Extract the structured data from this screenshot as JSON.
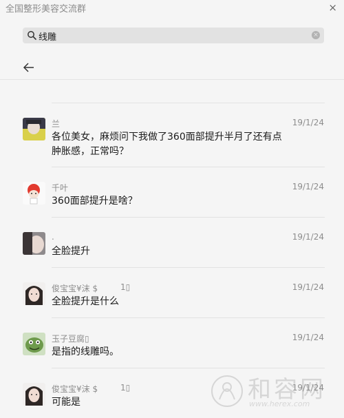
{
  "window": {
    "title": "全国整形美容交流群",
    "close_glyph": "×"
  },
  "search": {
    "value": "线雕",
    "clear_glyph": "×"
  },
  "results": [
    {
      "nickname": "兰",
      "extra": "",
      "date": "19/1/24",
      "message": "各位美女，麻烦问下我做了360面部提升半月了还有点肿胀感，正常吗？"
    },
    {
      "nickname": "千叶",
      "extra": "",
      "date": "19/1/24",
      "message": "360面部提升是啥？"
    },
    {
      "nickname": ".",
      "extra": "",
      "date": "19/1/24",
      "message": "全脸提升"
    },
    {
      "nickname": "俊宝宝¥沫 $",
      "extra": "1▯",
      "date": "19/1/24",
      "message": "全脸提升是什么"
    },
    {
      "nickname": "玉子豆腐▯",
      "extra": "",
      "date": "19/1/24",
      "message": "是指的线雕吗。"
    },
    {
      "nickname": "俊宝宝¥沫 $",
      "extra": "1▯",
      "date": "19/1/24",
      "message": "可能是"
    }
  ],
  "watermark": {
    "text": "和容网",
    "url": "www.herex.com"
  },
  "icons": {
    "search": "search-icon",
    "back": "back-arrow-icon",
    "clear": "clear-icon",
    "close": "close-icon"
  }
}
